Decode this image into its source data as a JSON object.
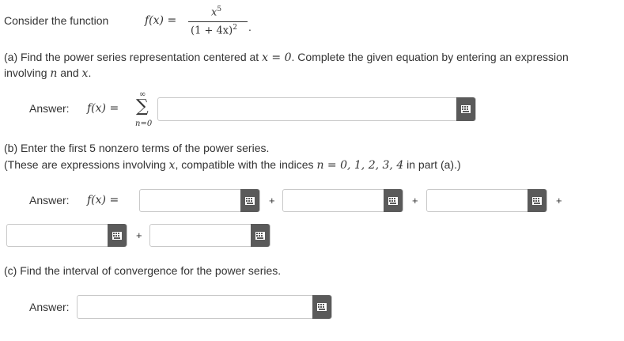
{
  "intro": {
    "label": "Consider the function",
    "f_lhs": "f(x) =",
    "numerator": "x",
    "numerator_exp": "5",
    "denominator": "(1 + 4x)",
    "denominator_exp": "2",
    "trailing": "."
  },
  "part_a": {
    "tag": "(a)",
    "line1_pre": "Find the power series representation centered at ",
    "line1_math": "x = 0",
    "line1_post": ". Complete the given equation by entering an expression",
    "line2_pre": "involving ",
    "line2_n": "n",
    "line2_and": " and ",
    "line2_x": "x",
    "line2_end": ".",
    "answer_label": "Answer:",
    "answer_lhs": "f(x) =",
    "sum_symbol": "∑",
    "sum_upper": "∞",
    "sum_lower": "n=0"
  },
  "part_b": {
    "tag": "(b)",
    "line1": "Enter the first 5 nonzero terms of the power series.",
    "line2_pre": "(These are expressions involving ",
    "line2_x": "x",
    "line2_mid": ", compatible with the indices ",
    "line2_math": "n = 0, 1, 2, 3, 4",
    "line2_in": " in part ",
    "line2_ref": "(a)",
    "line2_end": ".)",
    "answer_label": "Answer:",
    "answer_lhs": "f(x) =",
    "plus": "+"
  },
  "part_c": {
    "tag": "(c)",
    "text": "Find the interval of convergence for the power series.",
    "answer_label": "Answer:"
  },
  "colors": {
    "keyboard_button": "#5a5a5a",
    "field_border": "#c9c9c9",
    "text": "#333333"
  },
  "icons": {
    "keyboard": "keyboard-icon"
  }
}
